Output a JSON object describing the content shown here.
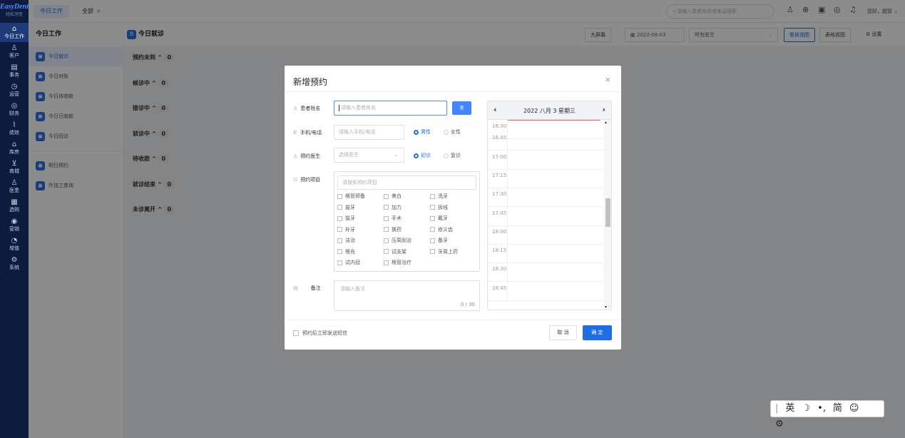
{
  "brand": {
    "name": "EasyDent",
    "subtitle": "轻松牙医"
  },
  "nav": [
    {
      "icon": "home-icon",
      "glyph": "⌂",
      "label": "今日工作",
      "active": true
    },
    {
      "icon": "customer-icon",
      "glyph": "♙",
      "label": "客户"
    },
    {
      "icon": "affairs-icon",
      "glyph": "▤",
      "label": "事务"
    },
    {
      "icon": "operation-icon",
      "glyph": "◷",
      "label": "运营"
    },
    {
      "icon": "finance-icon",
      "glyph": "◎",
      "label": "财务"
    },
    {
      "icon": "performance-icon",
      "glyph": "⌇",
      "label": "绩效"
    },
    {
      "icon": "warehouse-icon",
      "glyph": "⌂",
      "label": "库房"
    },
    {
      "icon": "mall-icon",
      "glyph": "⊻",
      "label": "商城"
    },
    {
      "icon": "doctor-icon",
      "glyph": "♙",
      "label": "医患"
    },
    {
      "icon": "select-icon",
      "glyph": "▦",
      "label": "选购"
    },
    {
      "icon": "marketing-icon",
      "glyph": "◉",
      "label": "营销"
    },
    {
      "icon": "value-added-icon",
      "glyph": "◔",
      "label": "增值"
    },
    {
      "icon": "system-icon",
      "glyph": "⚙",
      "label": "系统"
    }
  ],
  "tabs": [
    {
      "label": "今日工作",
      "active": true
    },
    {
      "label": "全部"
    }
  ],
  "topbar": {
    "search_placeholder": "请输入患者姓名或电话搜索",
    "greeting": "您好，超管"
  },
  "sidebar": {
    "title": "今日工作",
    "items": [
      {
        "label": "今日就诊",
        "active": true
      },
      {
        "label": "今日对账"
      },
      {
        "label": "今日待收款"
      },
      {
        "label": "今日已收款"
      },
      {
        "label": "今日回访"
      }
    ],
    "items2": [
      {
        "label": "明日预约"
      },
      {
        "label": "外加工查询"
      }
    ]
  },
  "content_header": {
    "title": "今日就诊",
    "big_screen": "大屏幕",
    "date": "2022-08-03",
    "doctor_select": "所有医生",
    "board_view": "看板视图",
    "table_view": "表格视图",
    "settings": "设置"
  },
  "status_groups": [
    {
      "label": "预约未到",
      "count": "0"
    },
    {
      "label": "候诊中",
      "count": "0"
    },
    {
      "label": "接诊中",
      "count": "0"
    },
    {
      "label": "就诊中",
      "count": "0"
    },
    {
      "label": "待收款",
      "count": "0"
    },
    {
      "label": "就诊结束",
      "count": "0"
    },
    {
      "label": "未诊离开",
      "count": "0"
    }
  ],
  "modal": {
    "title": "新增预约",
    "patient_label": "患者姓名",
    "patient_placeholder": "请输入患者姓名",
    "search_btn": "查",
    "phone_label": "手机/电话",
    "phone_placeholder": "请输入手机/电话",
    "male": "男性",
    "female": "女性",
    "doctor_label": "预约医生",
    "doctor_placeholder": "选择医生",
    "first_visit": "初诊",
    "revisit": "复诊",
    "project_label": "预约项目",
    "project_search_placeholder": "请搜索预约项目",
    "projects": [
      "根管预备",
      "美白",
      "洗牙",
      "拔牙",
      "加力",
      "拆线",
      "拔牙",
      "手术",
      "戴牙",
      "补牙",
      "换药",
      "修义齿",
      "洁治",
      "压周刮治",
      "备牙",
      "根充",
      "试支架",
      "牙周上药",
      "试内冠",
      "根管治疗"
    ],
    "note_label": "备注",
    "note_placeholder": "请输入备注",
    "note_count": "0 / 30",
    "sms_label": "预约后立即发送短信",
    "cancel": "取 消",
    "ok": "确 定"
  },
  "calendar": {
    "date_label": "2022 八月 3 星期三",
    "times": [
      "16:30",
      "16:45",
      "17:00",
      "17:15",
      "17:30",
      "17:45",
      "18:00",
      "18:15",
      "18:30",
      "18:45"
    ]
  },
  "ime": {
    "items": [
      "英",
      "☽",
      "•,",
      "简",
      "☺",
      "⚙"
    ]
  }
}
